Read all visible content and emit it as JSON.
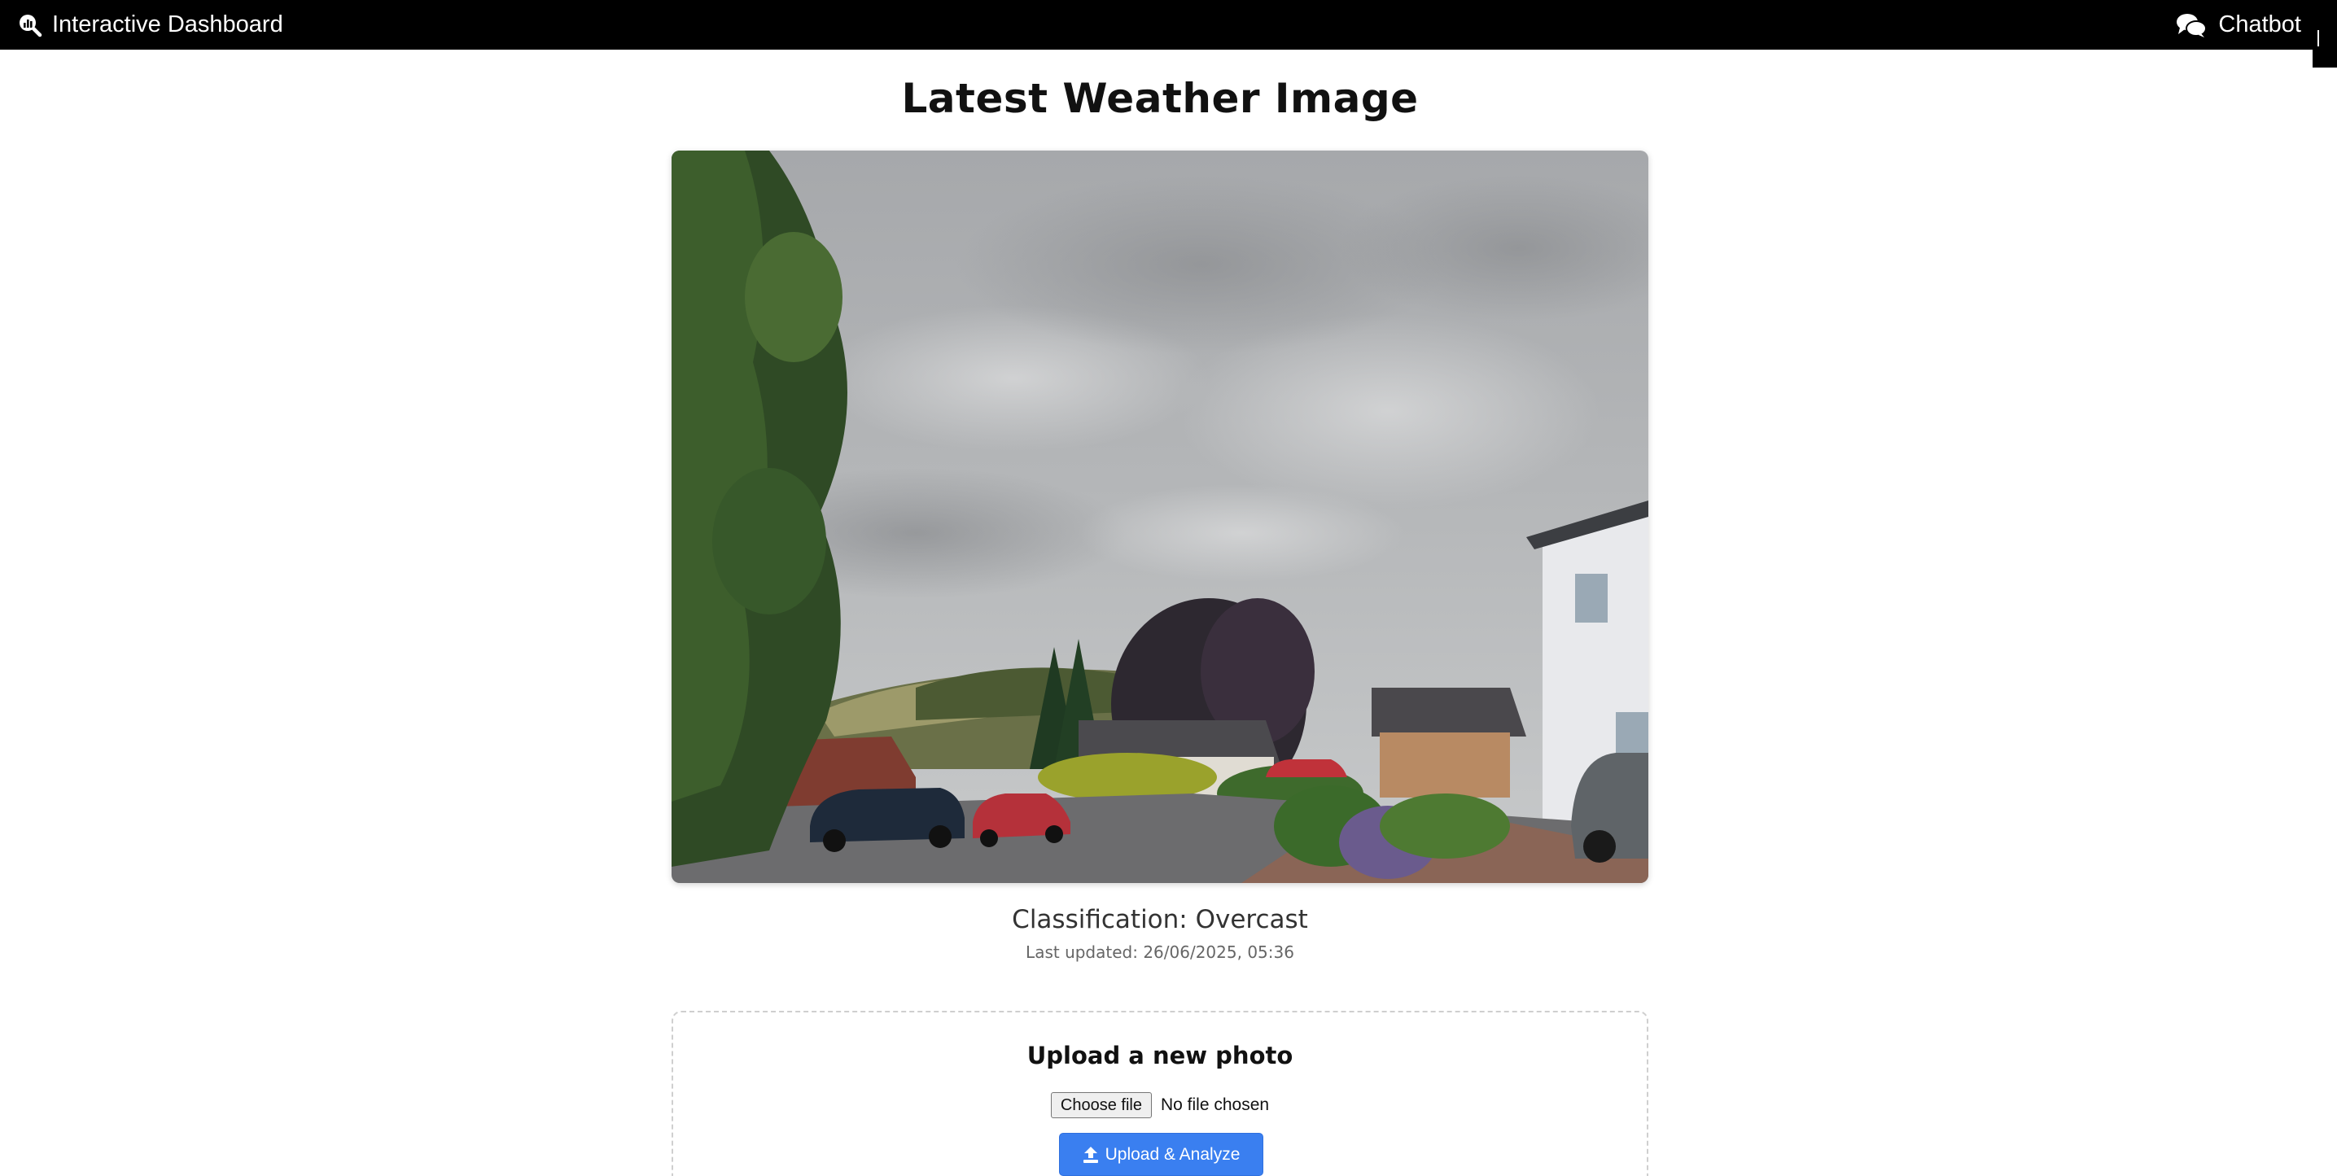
{
  "nav": {
    "brand_icon": "magnifier-chart-icon",
    "brand": "Interactive Dashboard",
    "chat_icon": "comments-icon",
    "chatbot": "Chatbot"
  },
  "page": {
    "title": "Latest Weather Image"
  },
  "image": {
    "alt": "Overcast sky over a residential street with parked cars, trees and distant hills"
  },
  "classification": {
    "text": "Classification: Overcast"
  },
  "last_updated": {
    "text": "Last updated: 26/06/2025, 05:36"
  },
  "upload": {
    "title": "Upload a new photo",
    "choose_file": "Choose file",
    "no_file": "No file chosen",
    "button_icon": "upload-icon",
    "button": "Upload & Analyze"
  },
  "colors": {
    "topbar": "#000000",
    "button": "#3a7ff0"
  }
}
